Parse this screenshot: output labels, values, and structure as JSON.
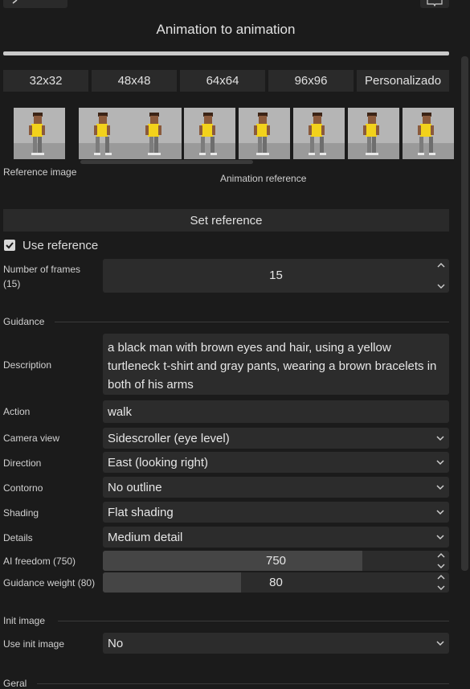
{
  "header": {
    "title": "Animation to animation",
    "progress": 1.0
  },
  "sizes": [
    "32x32",
    "48x48",
    "64x64",
    "96x96",
    "Personalizado"
  ],
  "reference": {
    "image_label": "Reference image",
    "animation_label": "Animation reference",
    "set_button": "Set reference",
    "use_reference_label": "Use reference",
    "use_reference_checked": true
  },
  "frames": {
    "label": "Number of frames (15)",
    "value": "15"
  },
  "guidance": {
    "section": "Guidance",
    "description_label": "Description",
    "description_value": "a black man with brown eyes and hair, using a yellow turtleneck t-shirt and gray pants, wearing a brown bracelets in both of his arms",
    "action_label": "Action",
    "action_value": "walk",
    "camera_label": "Camera view",
    "camera_value": "Sidescroller (eye level)",
    "direction_label": "Direction",
    "direction_value": "East (looking right)",
    "contorno_label": "Contorno",
    "contorno_value": "No outline",
    "shading_label": "Shading",
    "shading_value": "Flat shading",
    "details_label": "Details",
    "details_value": "Medium detail",
    "ai_freedom_label": "AI freedom (750)",
    "ai_freedom_value": "750",
    "ai_freedom_fraction": 0.75,
    "guidance_weight_label": "Guidance weight (80)",
    "guidance_weight_value": "80",
    "guidance_weight_fraction": 0.4
  },
  "init": {
    "section": "Init image",
    "use_label": "Use init image",
    "use_value": "No"
  },
  "geral": {
    "section": "Geral"
  },
  "colors": {
    "background": "#1b1b1b",
    "field": "#2c2c2c",
    "fill": "#454545",
    "shirt": "#f2d21b",
    "skin": "#8a5a3c"
  }
}
